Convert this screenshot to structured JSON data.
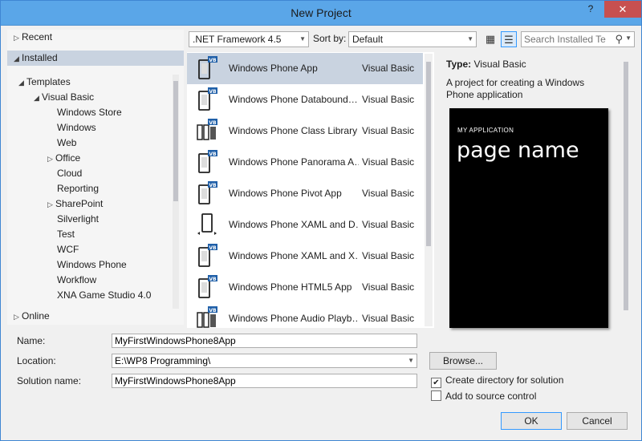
{
  "window": {
    "title": "New Project",
    "help": "?",
    "close": "✕"
  },
  "tree": {
    "recent": "Recent",
    "installed": "Installed",
    "templates": "Templates",
    "visual_basic": "Visual Basic",
    "children": [
      {
        "label": "Windows Store",
        "expandable": false
      },
      {
        "label": "Windows",
        "expandable": false
      },
      {
        "label": "Web",
        "expandable": false
      },
      {
        "label": "Office",
        "expandable": true
      },
      {
        "label": "Cloud",
        "expandable": false
      },
      {
        "label": "Reporting",
        "expandable": false
      },
      {
        "label": "SharePoint",
        "expandable": true
      },
      {
        "label": "Silverlight",
        "expandable": false
      },
      {
        "label": "Test",
        "expandable": false
      },
      {
        "label": "WCF",
        "expandable": false
      },
      {
        "label": "Windows Phone",
        "expandable": false,
        "selected": true
      },
      {
        "label": "Workflow",
        "expandable": false
      },
      {
        "label": "XNA Game Studio 4.0",
        "expandable": false
      }
    ],
    "online": "Online"
  },
  "toolbar": {
    "framework": ".NET Framework 4.5",
    "sort_label": "Sort by:",
    "sort_value": "Default",
    "search_placeholder": "Search Installed Te"
  },
  "templates": [
    {
      "name": "Windows Phone App",
      "lang": "Visual Basic",
      "icon": "phone-vb",
      "selected": true
    },
    {
      "name": "Windows Phone Databound…",
      "lang": "Visual Basic",
      "icon": "phone-vb"
    },
    {
      "name": "Windows Phone Class Library",
      "lang": "Visual Basic",
      "icon": "class-library-vb"
    },
    {
      "name": "Windows Phone Panorama A…",
      "lang": "Visual Basic",
      "icon": "phone-vb"
    },
    {
      "name": "Windows Phone Pivot App",
      "lang": "Visual Basic",
      "icon": "phone-vb"
    },
    {
      "name": "Windows Phone XAML and D…",
      "lang": "Visual Basic",
      "icon": "phone-xaml"
    },
    {
      "name": "Windows Phone XAML and X…",
      "lang": "Visual Basic",
      "icon": "phone-vb"
    },
    {
      "name": "Windows Phone HTML5 App",
      "lang": "Visual Basic",
      "icon": "phone-vb"
    },
    {
      "name": "Windows Phone Audio Playb…",
      "lang": "Visual Basic",
      "icon": "class-library-vb"
    }
  ],
  "details": {
    "type_label": "Type:",
    "type_value": "Visual Basic",
    "description": "A project for creating a Windows Phone application",
    "preview_app": "MY APPLICATION",
    "preview_page": "page name"
  },
  "form": {
    "name_label": "Name:",
    "name_value": "MyFirstWindowsPhone8App",
    "location_label": "Location:",
    "location_value": "E:\\WP8 Programming\\",
    "solution_label": "Solution name:",
    "solution_value": "MyFirstWindowsPhone8App",
    "browse": "Browse...",
    "create_dir": "Create directory for solution",
    "create_dir_checked": true,
    "add_source": "Add to source control",
    "add_source_checked": false,
    "ok": "OK",
    "cancel": "Cancel"
  }
}
